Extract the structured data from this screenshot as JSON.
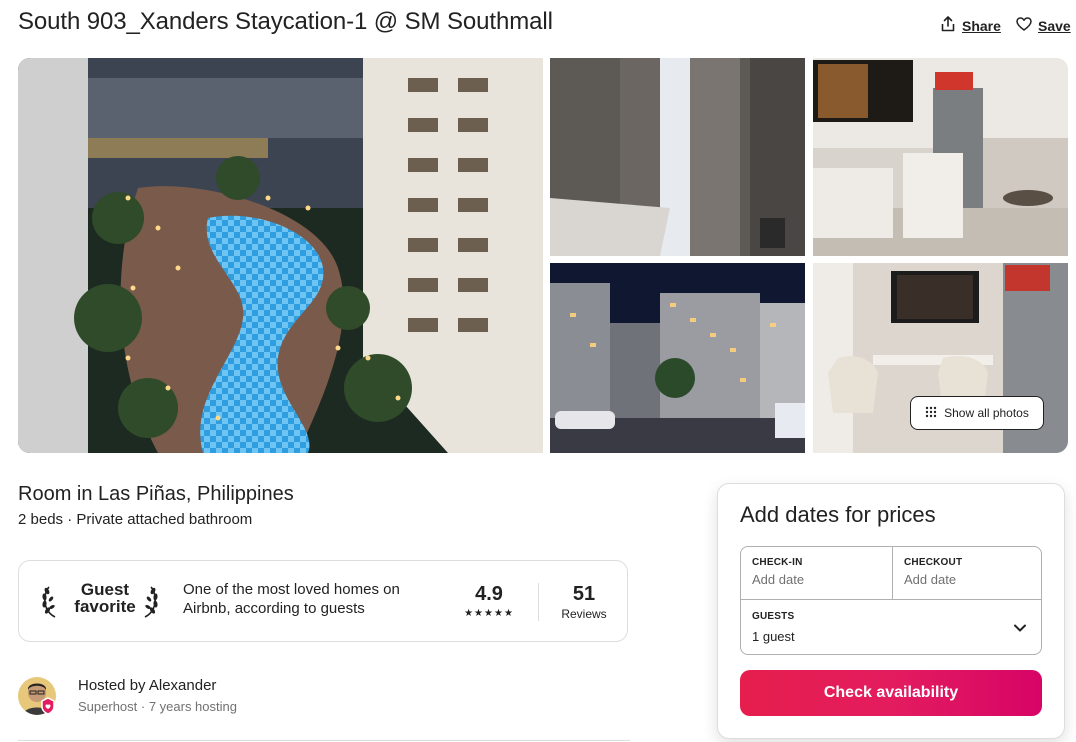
{
  "listing": {
    "title": "South 903_Xanders Staycation-1 @ SM Southmall",
    "share_label": "Share",
    "save_label": "Save"
  },
  "photos": {
    "show_all_label": "Show all photos"
  },
  "overview": {
    "subtitle": "Room in Las Piñas, Philippines",
    "details": "2 beds · Private attached bathroom"
  },
  "guest_favorite": {
    "badge_line1": "Guest",
    "badge_line2": "favorite",
    "description": "One of the most loved homes on Airbnb, according to guests",
    "rating": "4.9",
    "stars": "★★★★★",
    "reviews_count": "51",
    "reviews_label": "Reviews"
  },
  "host": {
    "hosted_by": "Hosted by Alexander",
    "subtext": "Superhost · 7 years hosting"
  },
  "booking": {
    "title": "Add dates for prices",
    "checkin_label": "CHECK-IN",
    "checkin_placeholder": "Add date",
    "checkout_label": "CHECKOUT",
    "checkout_placeholder": "Add date",
    "guests_label": "GUESTS",
    "guests_value": "1 guest",
    "cta_label": "Check availability"
  },
  "colors": {
    "brand": "#e31c5f",
    "text": "#222222",
    "muted": "#717171",
    "border": "#dddddd"
  },
  "icons": [
    "share-icon",
    "heart-icon",
    "grid-icon",
    "laurel-left-icon",
    "laurel-right-icon",
    "chevron-down-icon",
    "superhost-badge-icon"
  ]
}
